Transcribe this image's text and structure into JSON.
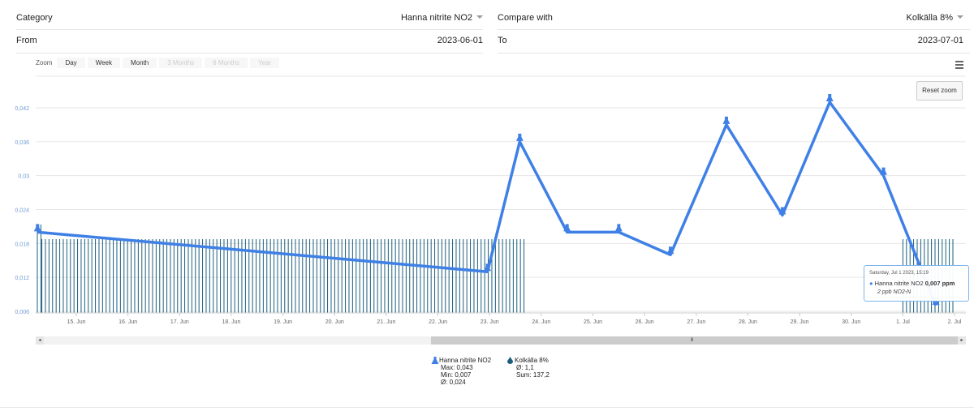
{
  "filters": {
    "category_label": "Category",
    "category_value": "Hanna nitrite NO2",
    "compare_label": "Compare with",
    "compare_value": "Kolkälla 8%",
    "from_label": "From",
    "from_value": "2023-06-01",
    "to_label": "To",
    "to_value": "2023-07-01"
  },
  "zoom": {
    "label": "Zoom",
    "buttons": [
      "Day",
      "Week",
      "Month",
      "3 Months",
      "6 Months",
      "Year"
    ],
    "disabled": [
      false,
      false,
      false,
      true,
      true,
      true
    ]
  },
  "reset_zoom_label": "Reset zoom",
  "tooltip": {
    "date": "Saturday, Jul 1 2023, 15:19",
    "series": "Hanna nitrite NO2",
    "value": "0,007 ppm",
    "sub": "2 ppb NO2-N"
  },
  "legend": [
    {
      "name": "Hanna nitrite NO2",
      "stats": [
        "Max: 0,043",
        "Min: 0,007",
        "Ø: 0,024"
      ]
    },
    {
      "name": "Kolkälla 8%",
      "stats": [
        "Ø: 1,1",
        "Sum: 137,2"
      ]
    }
  ],
  "colors": {
    "line": "#3f80e6",
    "bars": "#1c5f7d",
    "grid": "#e6e6e6",
    "axis_text": "#666666",
    "y_text": "#6d9bd1"
  },
  "chart_data": {
    "type": "line",
    "x_tick_labels": [
      "15. Jun",
      "16. Jun",
      "17. Jun",
      "18. Jun",
      "19. Jun",
      "20. Jun",
      "21. Jun",
      "22. Jun",
      "23. Jun",
      "24. Jun",
      "25. Jun",
      "26. Jun",
      "27. Jun",
      "28. Jun",
      "29. Jun",
      "30. Jun",
      "1. Jul",
      "2. Jul"
    ],
    "y_tick_labels": [
      "0,006",
      "0,012",
      "0,018",
      "0,024",
      "0,03",
      "0,036",
      "0,042"
    ],
    "ylim": [
      0.006,
      0.042
    ],
    "grid": true,
    "series": [
      {
        "name": "Hanna nitrite NO2",
        "x": [
          "2023-06-14T06:00",
          "2023-06-22T23:00",
          "2023-06-23T14:00",
          "2023-06-24T12:00",
          "2023-06-25T12:00",
          "2023-06-26T12:00",
          "2023-06-27T14:00",
          "2023-06-28T16:00",
          "2023-06-29T14:00",
          "2023-06-30T15:00",
          "2023-07-01T15:19"
        ],
        "y": [
          0.02,
          0.013,
          0.036,
          0.02,
          0.02,
          0.016,
          0.039,
          0.023,
          0.043,
          0.03,
          0.007
        ]
      },
      {
        "name": "Kolkälla 8%",
        "type": "bar",
        "note": "dense daily bar pattern in background",
        "ranges": [
          {
            "from": "2023-06-14T00:00",
            "to": "2023-06-14T08:00",
            "value": "high"
          },
          {
            "from": "2023-06-14T08:00",
            "to": "2023-06-23T16:00",
            "value": "medium"
          },
          {
            "from": "2023-07-01T00:00",
            "to": "2023-07-02T00:00",
            "value": "medium"
          }
        ]
      }
    ]
  }
}
